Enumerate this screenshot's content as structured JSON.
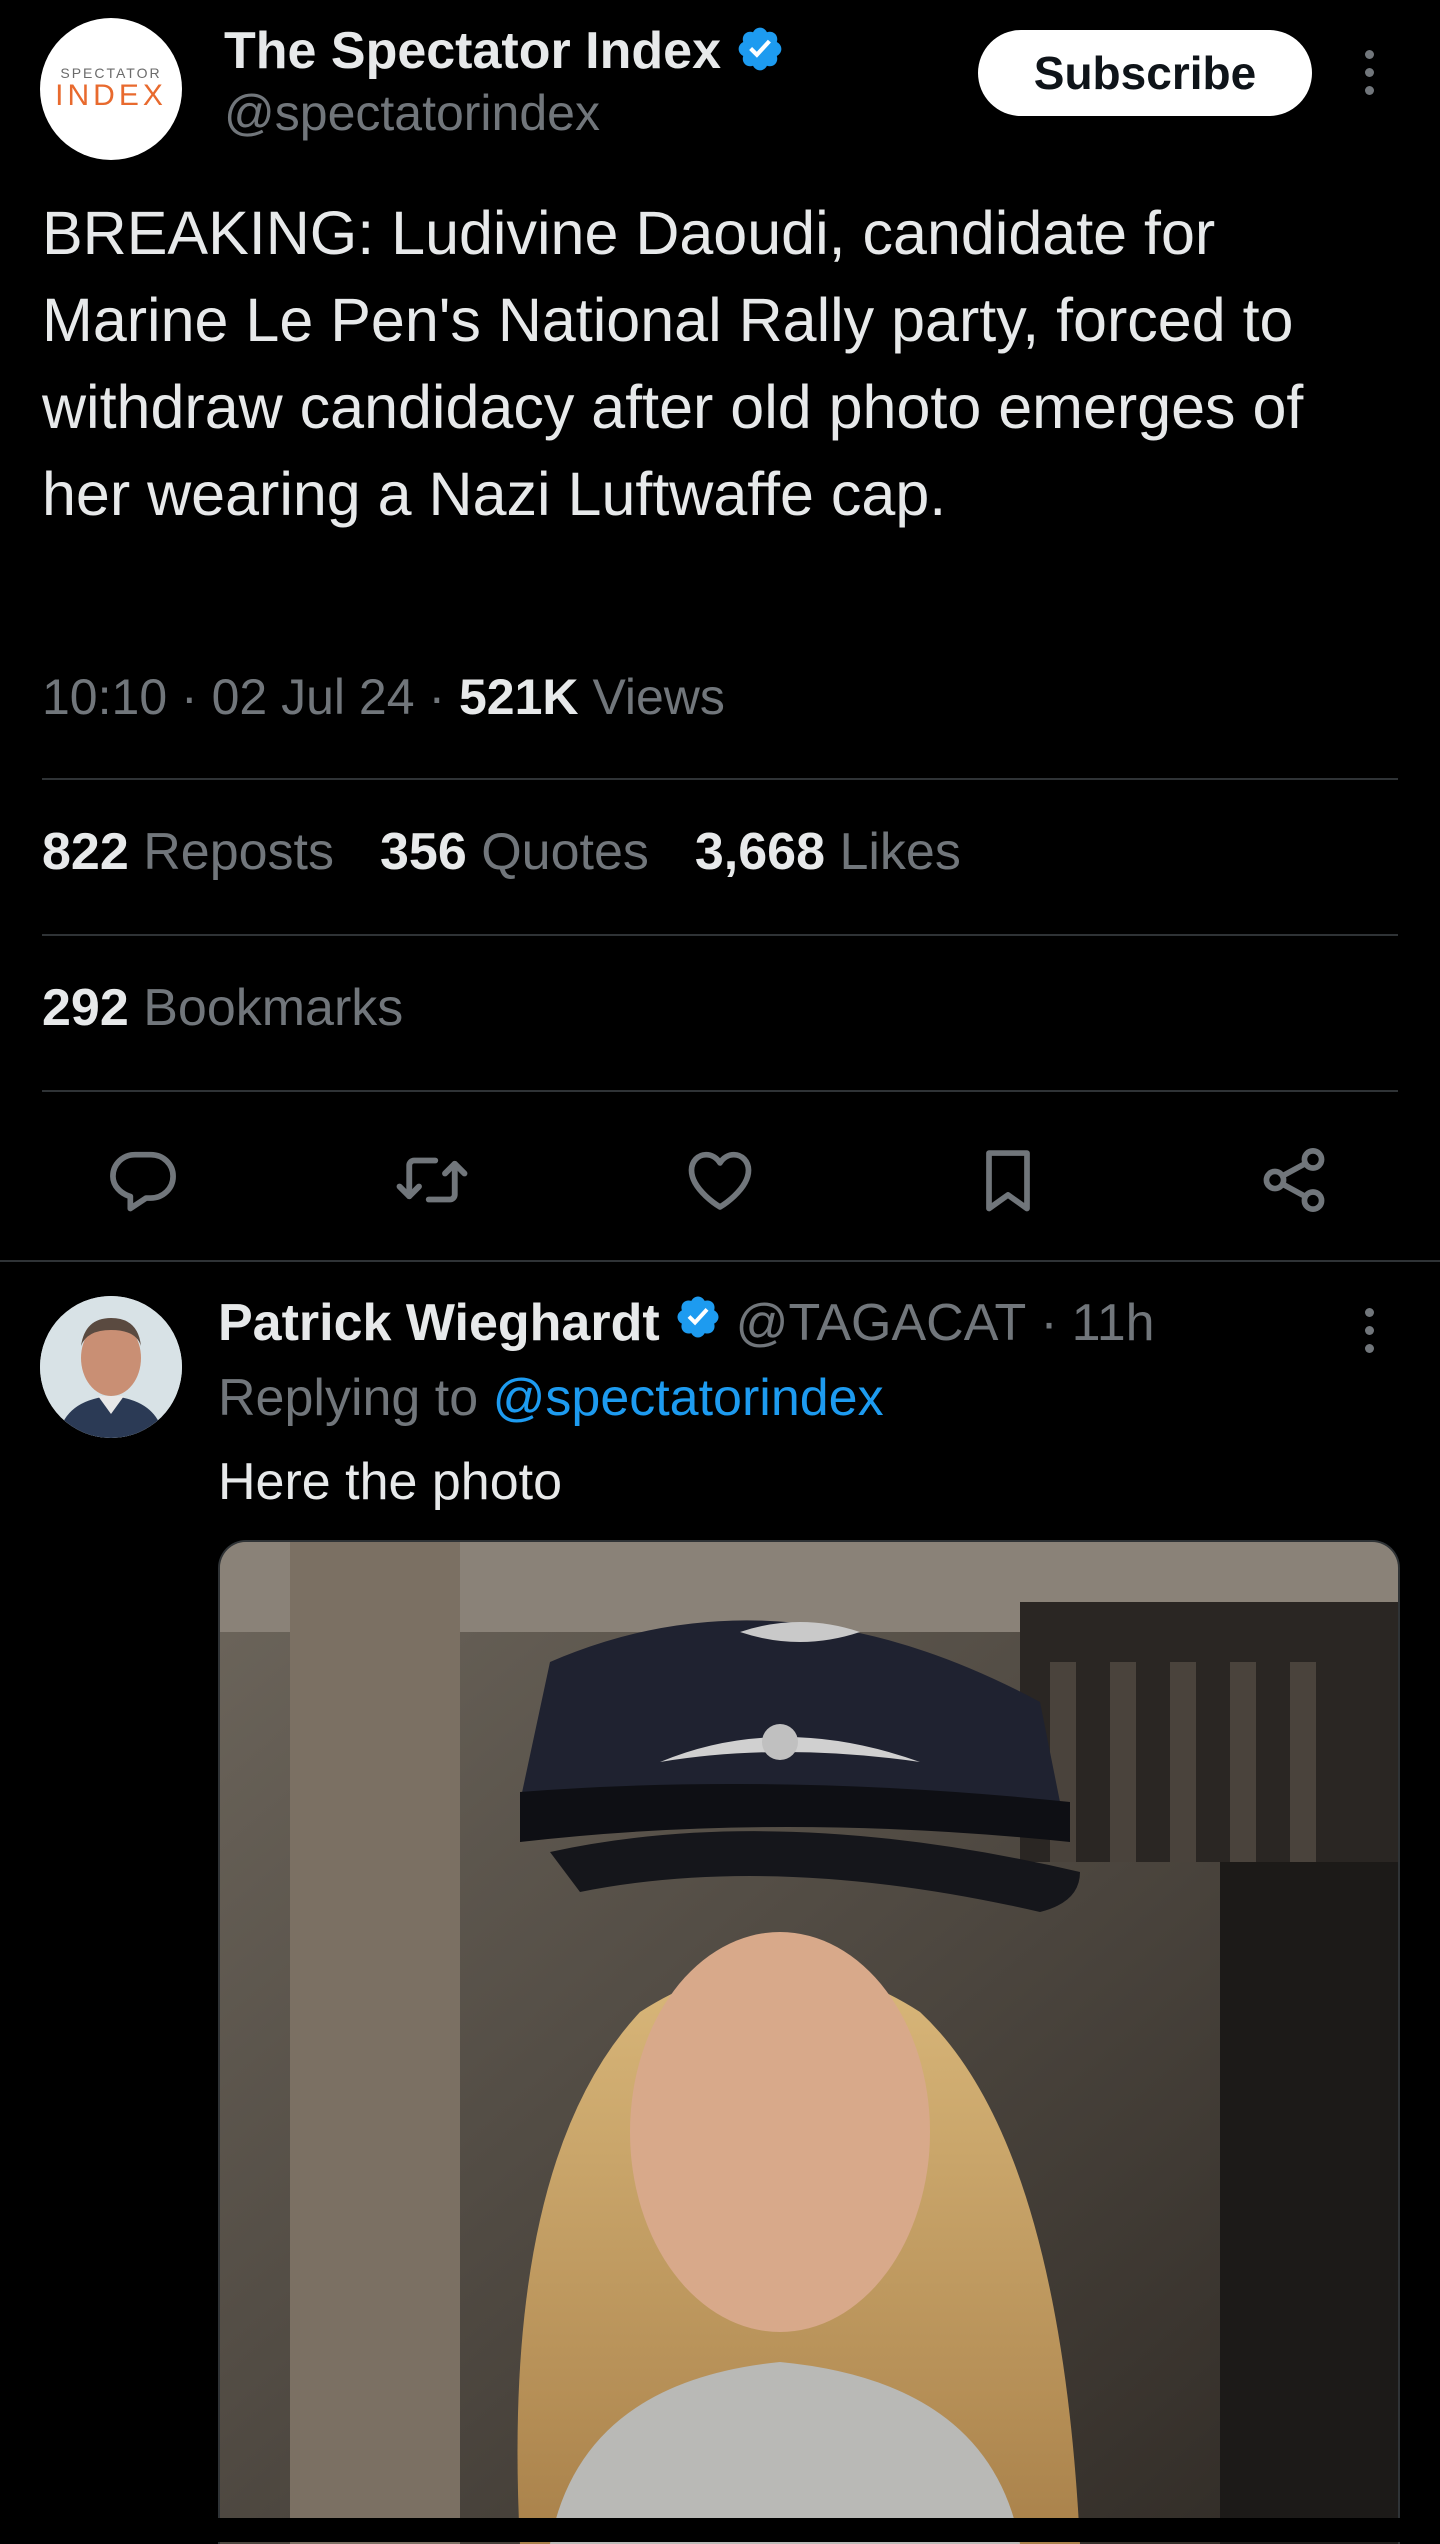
{
  "tweet": {
    "author_name": "The Spectator Index",
    "author_handle": "@spectatorindex",
    "logo_top": "SPECTATOR",
    "logo_bottom": "INDEX",
    "subscribe_label": "Subscribe",
    "text": "BREAKING: Ludivine Daoudi, candidate for Marine Le Pen's National Rally party, forced to withdraw candidacy after old photo emerges of her wearing a Nazi Luftwaffe cap.",
    "time": "10:10",
    "date": "02 Jul 24",
    "views_count": "521K",
    "views_label": "Views",
    "separator": "·",
    "stats": {
      "reposts_count": "822",
      "reposts_label": "Reposts",
      "quotes_count": "356",
      "quotes_label": "Quotes",
      "likes_count": "3,668",
      "likes_label": "Likes",
      "bookmarks_count": "292",
      "bookmarks_label": "Bookmarks"
    },
    "actions": [
      "reply-icon",
      "repost-icon",
      "like-icon",
      "bookmark-icon",
      "share-icon"
    ]
  },
  "reply": {
    "author_name": "Patrick Wieghardt",
    "author_handle": "@TAGACAT",
    "age": "11h",
    "replying_prefix": "Replying to",
    "replying_to": "@spectatorindex",
    "text": "Here the photo"
  },
  "colors": {
    "background": "#000000",
    "text": "#e7e9ea",
    "muted": "#71767b",
    "link": "#1d9bf0",
    "verified": "#1d9bf0",
    "logo_accent": "#e86a2e"
  }
}
